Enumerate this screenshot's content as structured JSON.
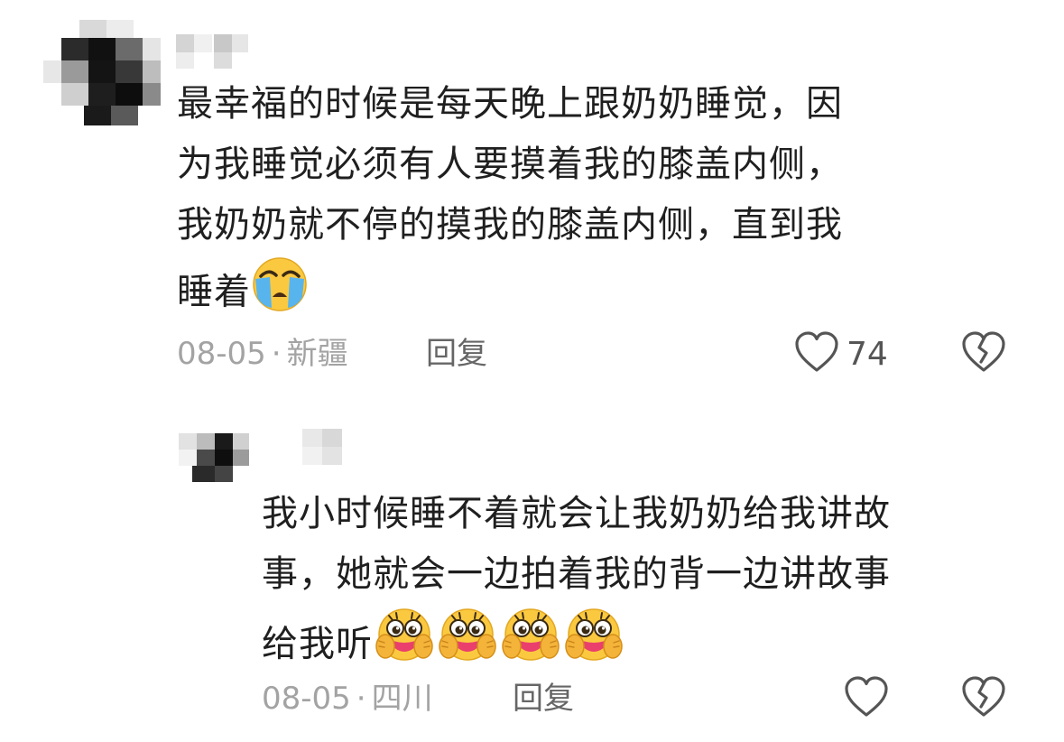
{
  "comments": [
    {
      "text_lines": [
        "最幸福的时候是每天晚上跟奶奶睡觉，因",
        "为我睡觉必须有人要摸着我的膝盖内侧，",
        "我奶奶就不停的摸我的膝盖内侧，直到我",
        "睡着"
      ],
      "trailing_emoji": "crying-face-emoji",
      "date": "08-05",
      "separator": "·",
      "location": "新疆",
      "reply_label": "回复",
      "like_count": "74",
      "avatar_icon": "pixelated-avatar",
      "username_icon": "pixelated-username"
    }
  ],
  "replies": [
    {
      "text_lines": [
        "我小时候睡不着就会让我奶奶给我讲故",
        "事，她就会一边拍着我的背一边讲故事",
        "给我听"
      ],
      "trailing_emoji": "happy-crying-hands-emoji",
      "trailing_emoji_count": 4,
      "date": "08-05",
      "separator": "·",
      "location": "四川",
      "reply_label": "回复",
      "like_count": "",
      "avatar_icon": "pixelated-avatar",
      "username_icon": "pixelated-username"
    }
  ],
  "icons": {
    "like": "heart-outline-icon",
    "dislike": "broken-heart-outline-icon"
  },
  "colors": {
    "text": "#1f1f1f",
    "meta": "#a3a3a3",
    "icon": "#555555"
  }
}
